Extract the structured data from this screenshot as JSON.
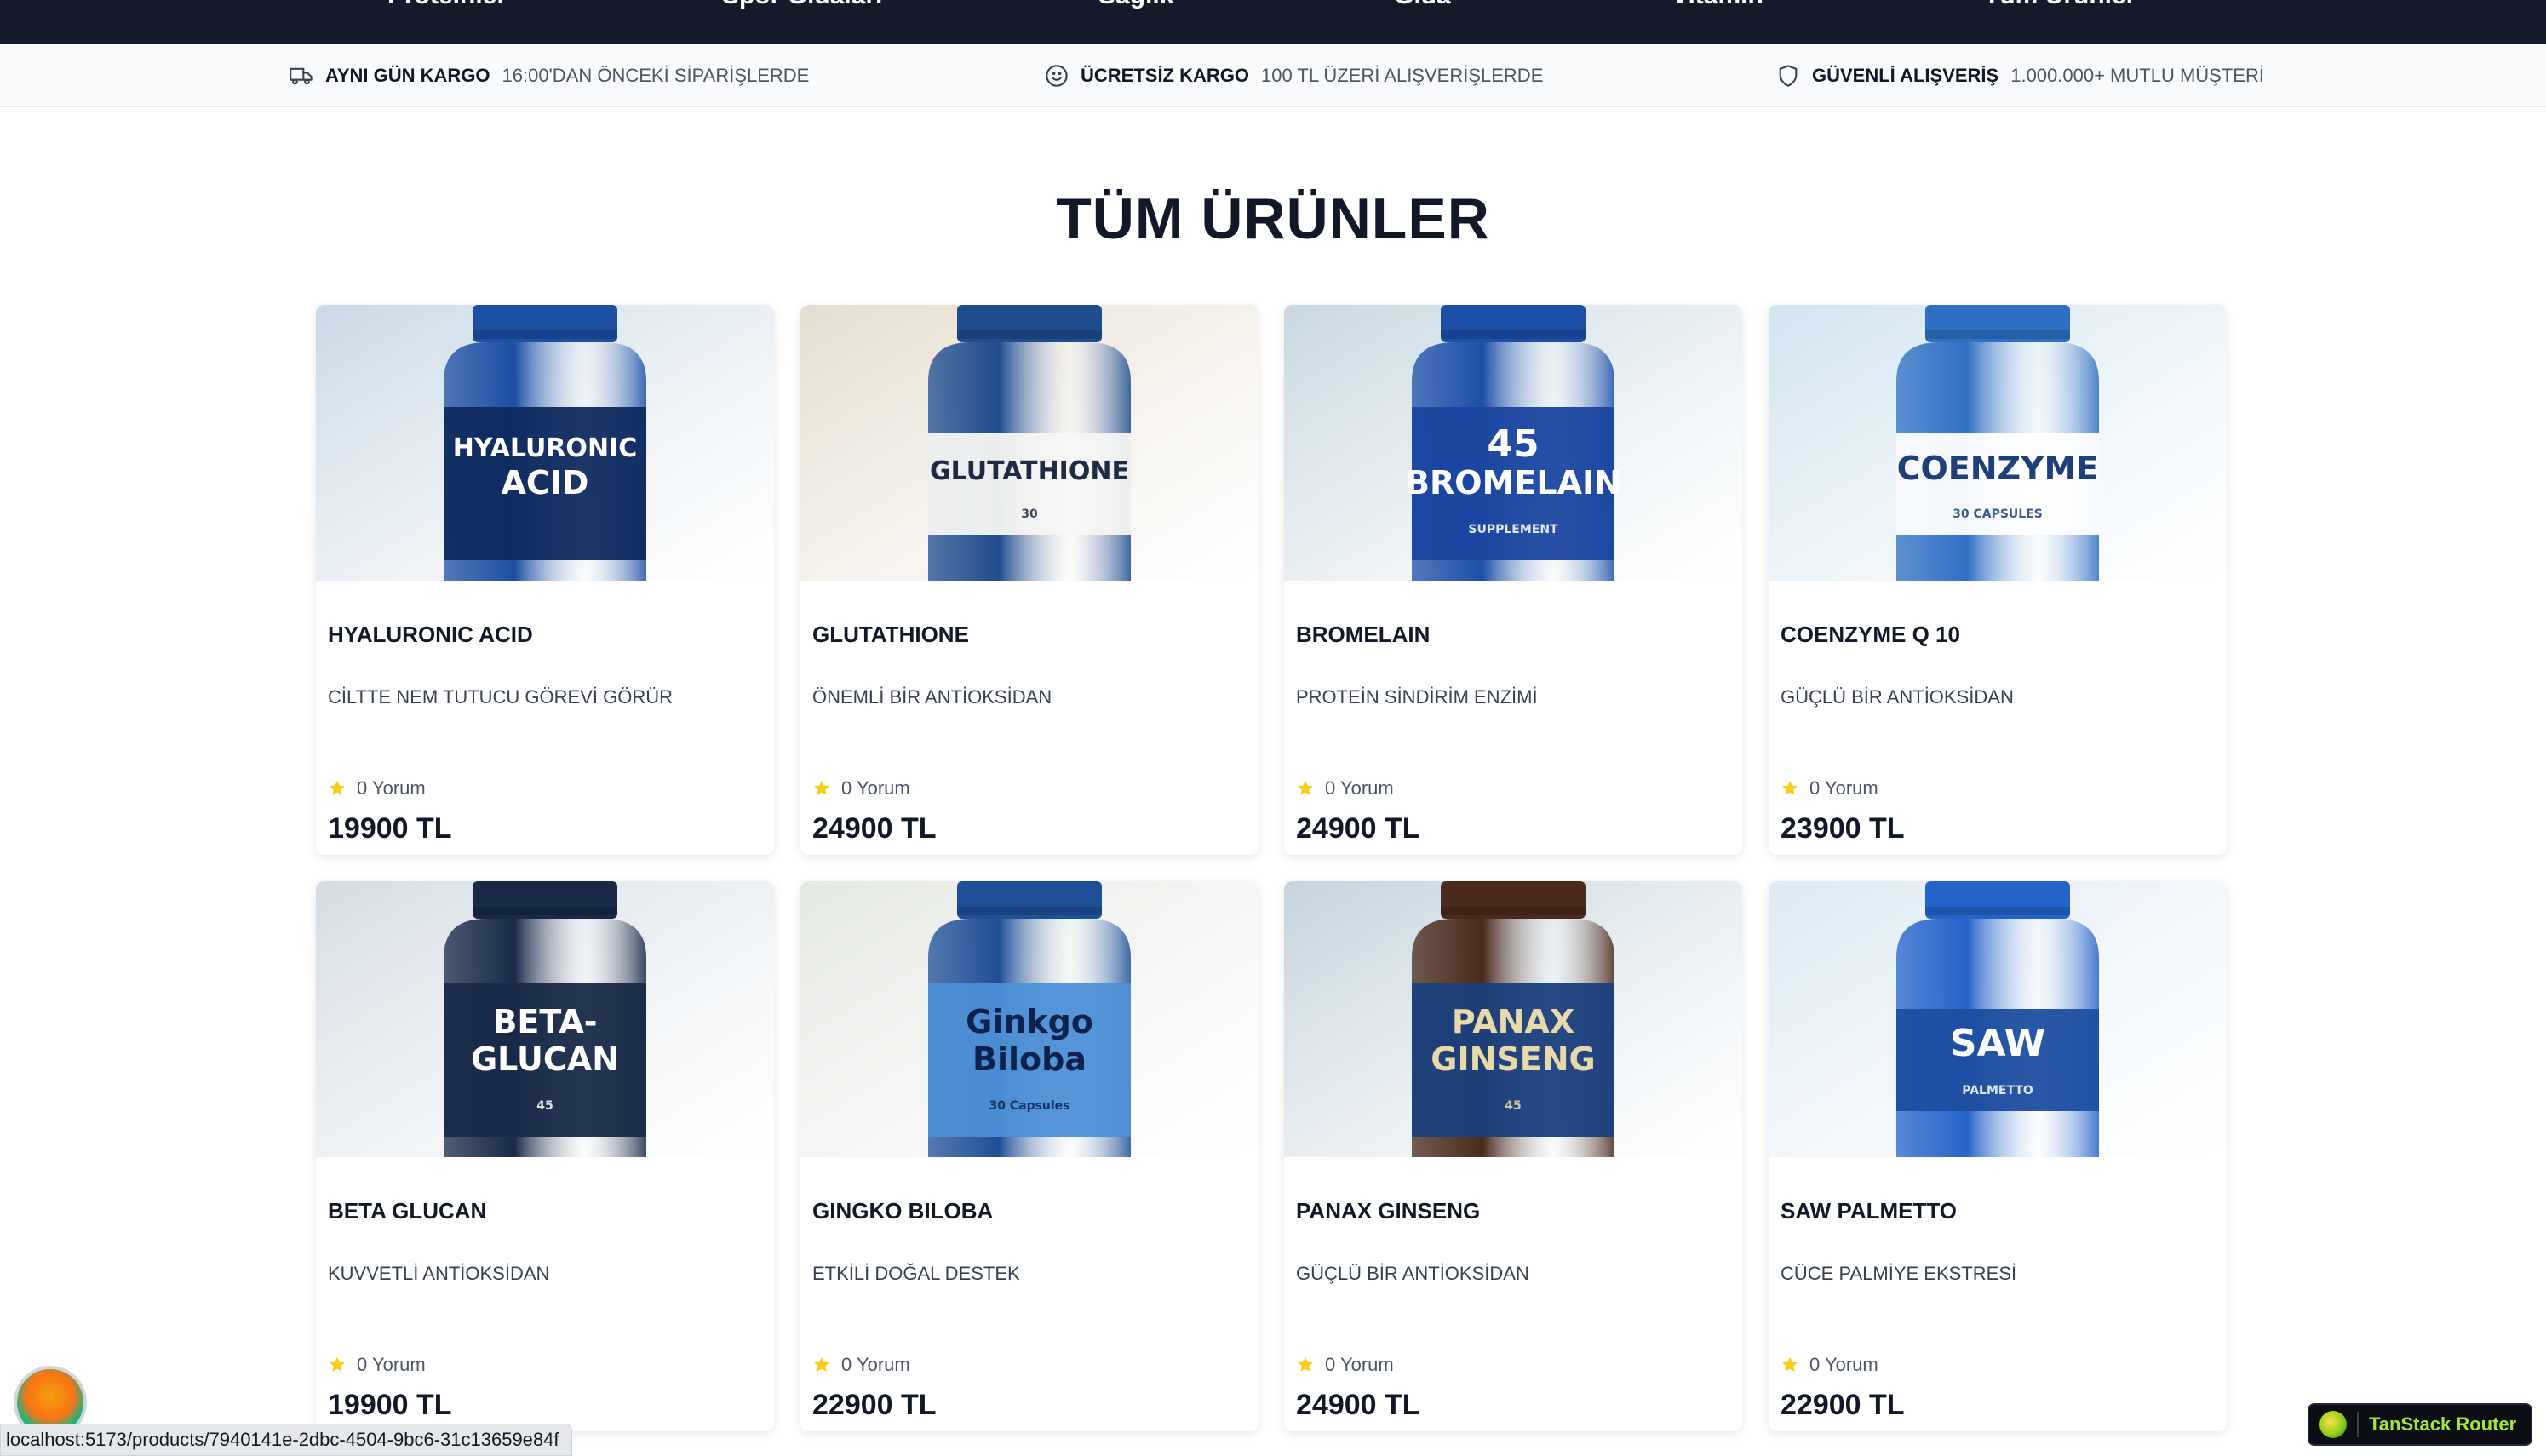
{
  "nav": {
    "items": [
      "Proteinler",
      "Spor Gıdaları",
      "Sağlık",
      "Gıda",
      "Vitamin",
      "Tüm Ürünler"
    ]
  },
  "info_strip": [
    {
      "icon": "truck-icon",
      "strong": "AYNI GÜN KARGO",
      "rest": "16:00'DAN ÖNCEKİ SİPARİŞLERDE"
    },
    {
      "icon": "smile-icon",
      "strong": "ÜCRETSİZ KARGO",
      "rest": "100 TL ÜZERİ ALIŞVERİŞLERDE"
    },
    {
      "icon": "shield-icon",
      "strong": "GÜVENLİ ALIŞVERİŞ",
      "rest": "1.000.000+ MUTLU MÜŞTERİ"
    }
  ],
  "section_title": "TÜM ÜRÜNLER",
  "products": [
    {
      "name": "HYALURONIC ACID",
      "desc": "CİLTTE NEM TUTUCU GÖREVİ GÖRÜR",
      "reviews": "0 Yorum",
      "price": "19900 TL",
      "label_lines": [
        "HYALURONIC",
        "ACID"
      ],
      "label_small": "",
      "bg": "#c9d9e6",
      "bottle": "#1d4fa3",
      "label_bg": "#0f2a5e",
      "label_fg": "#ffffff"
    },
    {
      "name": "GLUTATHIONE",
      "desc": "ÖNEMLİ BİR ANTİOKSİDAN",
      "reviews": "0 Yorum",
      "price": "24900 TL",
      "label_lines": [
        "GLUTATHIONE"
      ],
      "label_small": "30",
      "bg": "#e5dccd",
      "bottle": "#1f4c8f",
      "label_bg": "#f5f5f3",
      "label_fg": "#1f2a44"
    },
    {
      "name": "BROMELAIN",
      "desc": "PROTEİN SİNDİRİM ENZİMİ",
      "reviews": "0 Yorum",
      "price": "24900 TL",
      "label_lines": [
        "45",
        "BROMELAIN"
      ],
      "label_small": "SUPPLEMENT",
      "bg": "#c7d8e2",
      "bottle": "#1e4fa8",
      "label_bg": "#1a46a0",
      "label_fg": "#ffffff"
    },
    {
      "name": "COENZYME Q 10",
      "desc": "GÜÇLÜ BİR ANTİOKSİDAN",
      "reviews": "0 Yorum",
      "price": "23900 TL",
      "label_lines": [
        "COENZYME"
      ],
      "label_small": "30 CAPSULES",
      "bg": "#cfe3f0",
      "bottle": "#2f6fc4",
      "label_bg": "#ffffff",
      "label_fg": "#1d3f7a"
    },
    {
      "name": "BETA GLUCAN",
      "desc": "KUVVETLİ ANTİOKSİDAN",
      "reviews": "0 Yorum",
      "price": "19900 TL",
      "label_lines": [
        "BETA-",
        "GLUCAN"
      ],
      "label_small": "45",
      "bg": "#d3dce4",
      "bottle": "#182a48",
      "label_bg": "#182a48",
      "label_fg": "#ffffff"
    },
    {
      "name": "GINGKO BILOBA",
      "desc": "ETKİLİ DOĞAL DESTEK",
      "reviews": "0 Yorum",
      "price": "22900 TL",
      "label_lines": [
        "Ginkgo",
        "Biloba"
      ],
      "label_small": "30 Capsules",
      "bg": "#e4e8e2",
      "bottle": "#1f4f97",
      "label_bg": "#4d8fd6",
      "label_fg": "#0d234d"
    },
    {
      "name": "PANAX GINSENG",
      "desc": "GÜÇLÜ BİR ANTİOKSİDAN",
      "reviews": "0 Yorum",
      "price": "24900 TL",
      "label_lines": [
        "PANAX",
        "GINSENG"
      ],
      "label_small": "45",
      "bg": "#c3d3de",
      "bottle": "#4a2a1c",
      "label_bg": "#1b3f7c",
      "label_fg": "#e8d9a8"
    },
    {
      "name": "SAW PALMETTO",
      "desc": "CÜCE PALMİYE EKSTRESİ",
      "reviews": "0 Yorum",
      "price": "22900 TL",
      "label_lines": [
        "SAW"
      ],
      "label_small": "PALMETTO",
      "bg": "#dbe9f4",
      "bottle": "#2563c9",
      "label_bg": "#1e4ea0",
      "label_fg": "#ffffff"
    }
  ],
  "colors": {
    "star": "#facc15",
    "nav_bg": "#131b2a"
  },
  "status_url": "localhost:5173/products/7940141e-2dbc-4504-9bc6-31c13659e84f",
  "devtools_label": "TanStack Router"
}
